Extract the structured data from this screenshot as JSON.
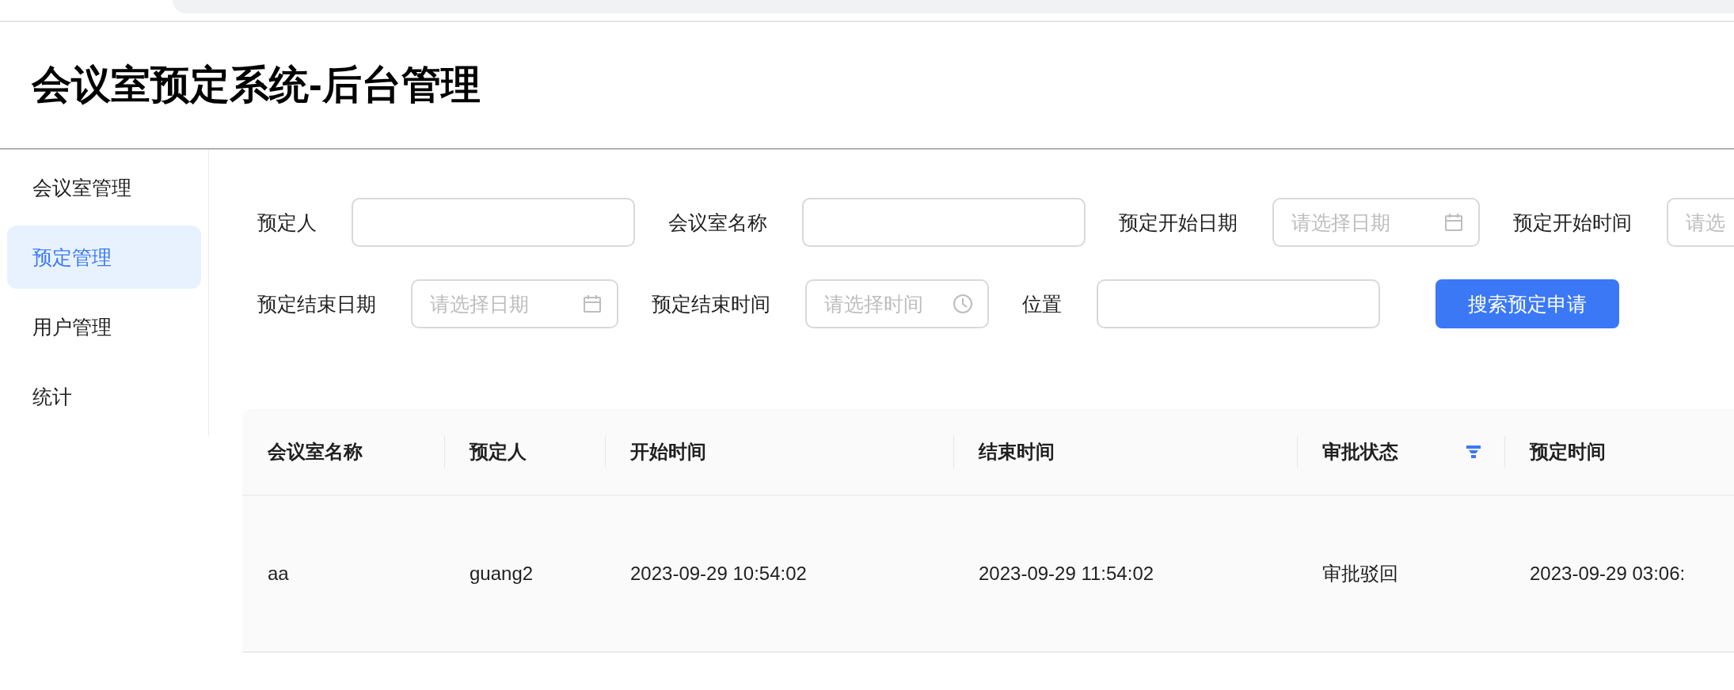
{
  "header": {
    "title": "会议室预定系统-后台管理"
  },
  "sidebar": {
    "items": [
      {
        "label": "会议室管理",
        "selected": false
      },
      {
        "label": "预定管理",
        "selected": true
      },
      {
        "label": "用户管理",
        "selected": false
      },
      {
        "label": "统计",
        "selected": false
      }
    ]
  },
  "search_form": {
    "rows": [
      [
        {
          "label": "预定人",
          "kind": "text"
        },
        {
          "label": "会议室名称",
          "kind": "text"
        },
        {
          "label": "预定开始日期",
          "kind": "date",
          "placeholder": "请选择日期"
        },
        {
          "label": "预定开始时间",
          "kind": "text",
          "placeholder": "请选"
        }
      ],
      [
        {
          "label": "预定结束日期",
          "kind": "date",
          "placeholder": "请选择日期"
        },
        {
          "label": "预定结束时间",
          "kind": "time",
          "placeholder": "请选择时间"
        },
        {
          "label": "位置",
          "kind": "text"
        }
      ]
    ],
    "button": "搜索预定申请"
  },
  "table": {
    "columns": [
      {
        "label": "会议室名称",
        "filter": false
      },
      {
        "label": "预定人",
        "filter": false
      },
      {
        "label": "开始时间",
        "filter": false
      },
      {
        "label": "结束时间",
        "filter": false
      },
      {
        "label": "审批状态",
        "filter": true
      },
      {
        "label": "预定时间",
        "filter": false
      }
    ],
    "rows": [
      [
        "aa",
        "guang2",
        "2023-09-29 10:54:02",
        "2023-09-29 11:54:02",
        "审批驳回",
        "2023-09-29 03:06:"
      ]
    ]
  }
}
